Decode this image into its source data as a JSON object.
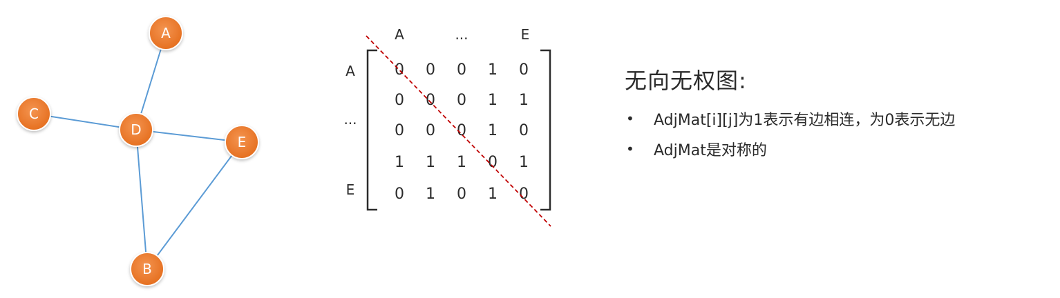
{
  "graph": {
    "nodes": [
      {
        "id": "A",
        "label": "A"
      },
      {
        "id": "C",
        "label": "C"
      },
      {
        "id": "D",
        "label": "D"
      },
      {
        "id": "E",
        "label": "E"
      },
      {
        "id": "B",
        "label": "B"
      }
    ],
    "edges": [
      [
        "A",
        "D"
      ],
      [
        "C",
        "D"
      ],
      [
        "D",
        "E"
      ],
      [
        "D",
        "B"
      ],
      [
        "E",
        "B"
      ]
    ],
    "node_color": "#ed7d31",
    "node_stroke": "#ffffff",
    "edge_color": "#5b9bd5"
  },
  "matrix": {
    "col_headers": [
      "A",
      "...",
      "E"
    ],
    "row_headers": [
      "A",
      "...",
      "E"
    ],
    "rows": [
      [
        "0",
        "0",
        "0",
        "1",
        "0"
      ],
      [
        "0",
        "0",
        "0",
        "1",
        "1"
      ],
      [
        "0",
        "0",
        "0",
        "1",
        "0"
      ],
      [
        "1",
        "1",
        "1",
        "0",
        "1"
      ],
      [
        "0",
        "1",
        "0",
        "1",
        "0"
      ]
    ],
    "diagonal_color": "#c00000"
  },
  "panel": {
    "title": "无向无权图:",
    "bullets": [
      "AdjMat[i][j]为1表示有边相连，为0表示无边",
      "AdjMat是对称的"
    ],
    "bullet_symbol": "•"
  }
}
